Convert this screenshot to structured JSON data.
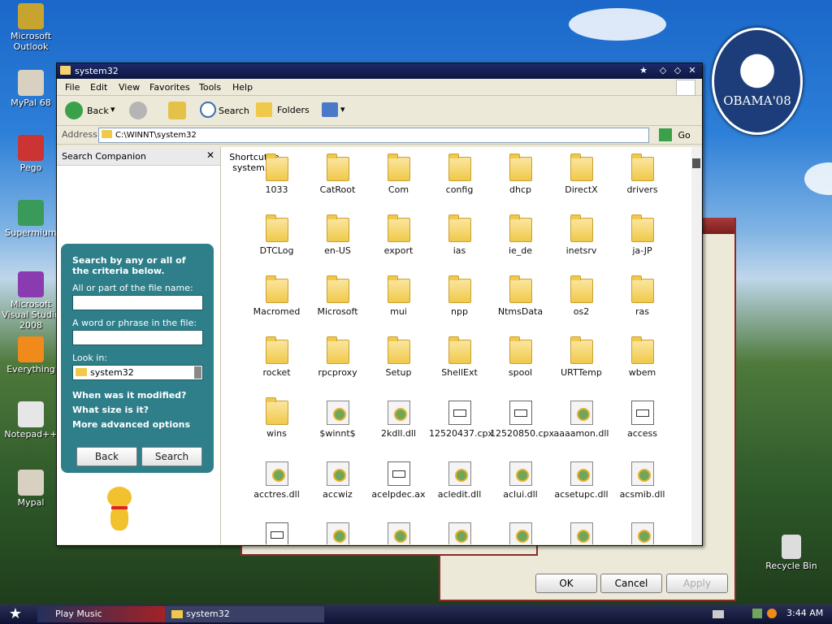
{
  "desktop": {
    "icons": [
      {
        "label": "Microsoft Outlook",
        "name": "outlook-icon"
      },
      {
        "label": "MyPal 68",
        "name": "mypal68-icon"
      },
      {
        "label": "Pego",
        "name": "pego-icon"
      },
      {
        "label": "Supermium",
        "name": "supermium-icon"
      },
      {
        "label": "Microsoft Visual Studio 2008",
        "name": "visual-studio-icon"
      },
      {
        "label": "Everything",
        "name": "everything-icon"
      },
      {
        "label": "Notepad++",
        "name": "notepadpp-icon"
      },
      {
        "label": "Mypal",
        "name": "mypal-icon"
      }
    ],
    "recycle_bin": "Recycle Bin",
    "badge_text": "OBAMA'08"
  },
  "window": {
    "title": "system32",
    "menu": [
      "File",
      "Edit",
      "View",
      "Favorites",
      "Tools",
      "Help"
    ],
    "toolbar": {
      "back": "Back",
      "search": "Search",
      "folders": "Folders"
    },
    "address": {
      "label": "Address",
      "value": "C:\\WINNT\\system32",
      "go": "Go"
    }
  },
  "companion": {
    "title": "Search Companion",
    "heading": "Search by any or all of the criteria below.",
    "file_name_label": "All or part of the file name:",
    "file_name_value": "",
    "word_label": "A word or phrase in the file:",
    "word_value": "",
    "look_in_label": "Look in:",
    "look_in_value": "system32",
    "options": [
      "When was it modified?",
      "What size is it?",
      "More advanced options"
    ],
    "back_button": "Back",
    "search_button": "Search"
  },
  "files": {
    "shortcut": "Shortcut to system32",
    "items": [
      {
        "name": "1033",
        "type": "folder"
      },
      {
        "name": "CatRoot",
        "type": "folder"
      },
      {
        "name": "Com",
        "type": "folder"
      },
      {
        "name": "config",
        "type": "folder"
      },
      {
        "name": "dhcp",
        "type": "folder"
      },
      {
        "name": "DirectX",
        "type": "folder"
      },
      {
        "name": "drivers",
        "type": "folder"
      },
      {
        "name": "DTCLog",
        "type": "folder"
      },
      {
        "name": "en-US",
        "type": "folder"
      },
      {
        "name": "export",
        "type": "folder"
      },
      {
        "name": "ias",
        "type": "folder"
      },
      {
        "name": "ie_de",
        "type": "folder"
      },
      {
        "name": "inetsrv",
        "type": "folder"
      },
      {
        "name": "ja-JP",
        "type": "folder"
      },
      {
        "name": "Macromed",
        "type": "folder"
      },
      {
        "name": "Microsoft",
        "type": "folder"
      },
      {
        "name": "mui",
        "type": "folder"
      },
      {
        "name": "npp",
        "type": "folder"
      },
      {
        "name": "NtmsData",
        "type": "folder"
      },
      {
        "name": "os2",
        "type": "folder"
      },
      {
        "name": "ras",
        "type": "folder"
      },
      {
        "name": "rocket",
        "type": "folder"
      },
      {
        "name": "rpcproxy",
        "type": "folder"
      },
      {
        "name": "Setup",
        "type": "folder"
      },
      {
        "name": "ShellExt",
        "type": "folder"
      },
      {
        "name": "spool",
        "type": "folder"
      },
      {
        "name": "URTTemp",
        "type": "folder"
      },
      {
        "name": "wbem",
        "type": "folder"
      },
      {
        "name": "wins",
        "type": "folder"
      },
      {
        "name": "$winnt$",
        "type": "gear"
      },
      {
        "name": "2kdll.dll",
        "type": "gear"
      },
      {
        "name": "12520437.cpx",
        "type": "doc"
      },
      {
        "name": "12520850.cpx",
        "type": "doc"
      },
      {
        "name": "aaaamon.dll",
        "type": "gear"
      },
      {
        "name": "access",
        "type": "doc"
      },
      {
        "name": "acctres.dll",
        "type": "gear"
      },
      {
        "name": "accwiz",
        "type": "gear"
      },
      {
        "name": "acelpdec.ax",
        "type": "doc"
      },
      {
        "name": "acledit.dll",
        "type": "gear"
      },
      {
        "name": "aclui.dll",
        "type": "gear"
      },
      {
        "name": "acsetupc.dll",
        "type": "gear"
      },
      {
        "name": "acsmib.dll",
        "type": "gear"
      },
      {
        "name": "",
        "type": "doc"
      },
      {
        "name": "",
        "type": "gear"
      },
      {
        "name": "",
        "type": "gear"
      },
      {
        "name": "",
        "type": "gear"
      },
      {
        "name": "",
        "type": "gear"
      },
      {
        "name": "",
        "type": "gear"
      },
      {
        "name": "",
        "type": "gear"
      }
    ]
  },
  "bg_dialog": {
    "ok": "OK",
    "cancel": "Cancel",
    "apply": "Apply"
  },
  "taskbar": {
    "task1": "Play Music",
    "task2": "system32",
    "clock": "3:44 AM"
  }
}
